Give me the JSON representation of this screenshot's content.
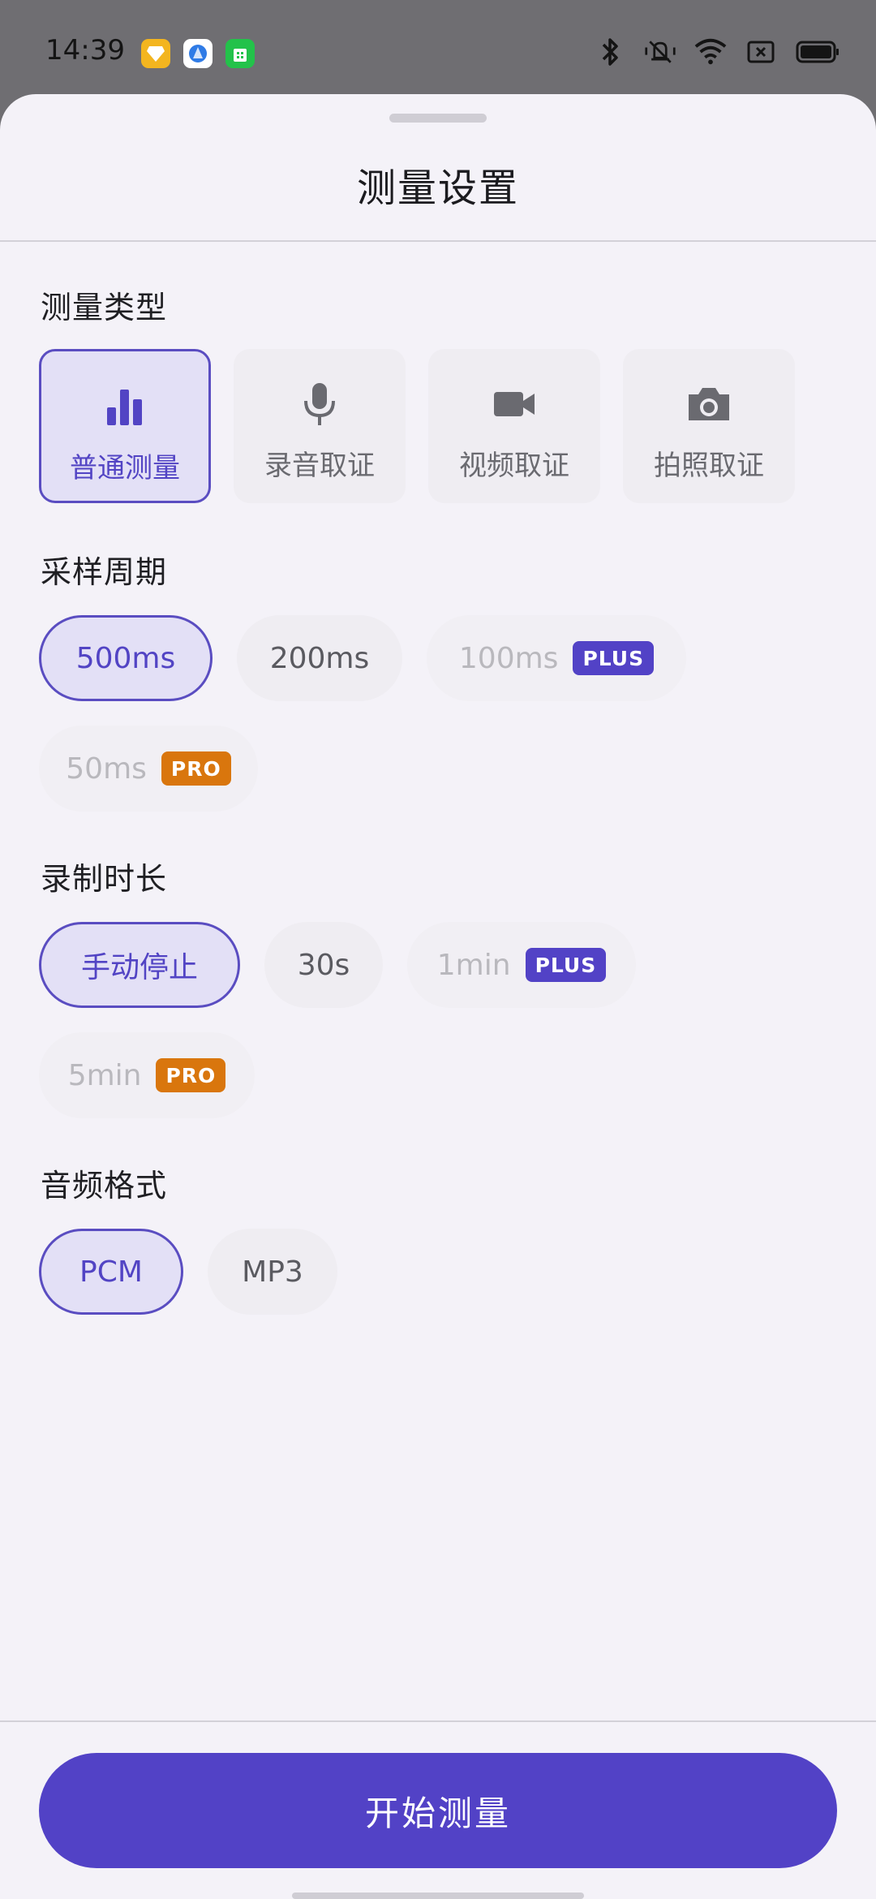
{
  "status_bar": {
    "time": "14:39",
    "apps": [
      "diamond-app-icon",
      "browser-app-icon",
      "store-app-icon"
    ],
    "icons": [
      "bluetooth-icon",
      "mute-icon",
      "wifi-icon",
      "sim-icon",
      "battery-icon"
    ]
  },
  "sheet": {
    "title": "测量设置",
    "measure_type": {
      "label": "测量类型",
      "options": [
        {
          "label": "普通测量",
          "icon": "bar-chart-icon",
          "selected": true
        },
        {
          "label": "录音取证",
          "icon": "microphone-icon",
          "selected": false
        },
        {
          "label": "视频取证",
          "icon": "video-camera-icon",
          "selected": false
        },
        {
          "label": "拍照取证",
          "icon": "camera-icon",
          "selected": false
        }
      ]
    },
    "sampling": {
      "label": "采样周期",
      "options": [
        {
          "label": "500ms",
          "selected": true,
          "badge": ""
        },
        {
          "label": "200ms",
          "selected": false,
          "badge": ""
        },
        {
          "label": "100ms",
          "selected": false,
          "badge": "PLUS"
        },
        {
          "label": "50ms",
          "selected": false,
          "badge": "PRO"
        }
      ]
    },
    "duration": {
      "label": "录制时长",
      "options": [
        {
          "label": "手动停止",
          "selected": true,
          "badge": ""
        },
        {
          "label": "30s",
          "selected": false,
          "badge": ""
        },
        {
          "label": "1min",
          "selected": false,
          "badge": "PLUS"
        },
        {
          "label": "5min",
          "selected": false,
          "badge": "PRO"
        }
      ]
    },
    "audio_format": {
      "label": "音频格式",
      "options": [
        {
          "label": "PCM",
          "selected": true
        },
        {
          "label": "MP3",
          "selected": false
        }
      ]
    },
    "start_label": "开始测量"
  },
  "colors": {
    "accent": "#5242c6",
    "plus_badge": "#5242c6",
    "pro_badge": "#d9760d",
    "selected_bg": "#e3e0f6"
  }
}
